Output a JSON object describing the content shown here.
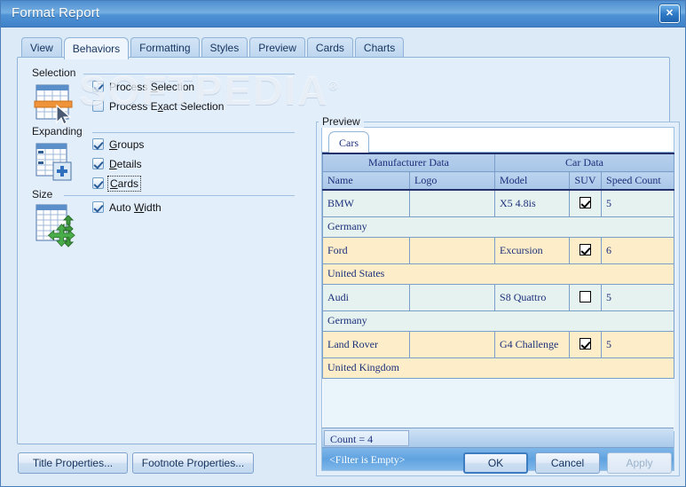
{
  "window": {
    "title": "Format Report",
    "close_label": "✕"
  },
  "watermark": {
    "text": "SOFTPEDIA"
  },
  "tabs": [
    {
      "label": "View",
      "active": false
    },
    {
      "label": "Behaviors",
      "active": true
    },
    {
      "label": "Formatting",
      "active": false
    },
    {
      "label": "Styles",
      "active": false
    },
    {
      "label": "Preview",
      "active": false
    },
    {
      "label": "Cards",
      "active": false
    },
    {
      "label": "Charts",
      "active": false
    }
  ],
  "groups": {
    "selection": {
      "label": "Selection",
      "icon": "table-row-select-icon",
      "options": [
        {
          "label_pre": "Process ",
          "accel": "S",
          "label_post": "election",
          "checked": true
        },
        {
          "label_pre": "Process E",
          "accel": "x",
          "label_post": "act Selection",
          "checked": false
        }
      ]
    },
    "expanding": {
      "label": "Expanding",
      "icon": "table-expand-plus-icon",
      "options": [
        {
          "label_pre": "",
          "accel": "G",
          "label_post": "roups",
          "checked": true,
          "focused": false
        },
        {
          "label_pre": "",
          "accel": "D",
          "label_post": "etails",
          "checked": true,
          "focused": false
        },
        {
          "label_pre": "",
          "accel": "C",
          "label_post": "ards",
          "checked": true,
          "focused": true
        }
      ]
    },
    "size": {
      "label": "Size",
      "icon": "table-resize-arrows-icon",
      "options": [
        {
          "label_pre": "Auto ",
          "accel": "W",
          "label_post": "idth",
          "checked": true
        }
      ]
    }
  },
  "preview": {
    "label": "Preview",
    "grid_tab": "Cars",
    "band_headers": [
      {
        "label": "Manufacturer Data",
        "span": 2
      },
      {
        "label": "Car Data",
        "span": 3
      }
    ],
    "columns": [
      "Name",
      "Logo",
      "Model",
      "SUV",
      "Speed Count"
    ],
    "rows": [
      {
        "type": "data",
        "name": "BMW",
        "logo": "",
        "model": "X5 4.8is",
        "suv": true,
        "speed": "5",
        "tone": "a"
      },
      {
        "type": "group",
        "text": "Germany",
        "tone": "a"
      },
      {
        "type": "data",
        "name": "Ford",
        "logo": "",
        "model": "Excursion",
        "suv": true,
        "speed": "6",
        "tone": "b"
      },
      {
        "type": "group",
        "text": "United States",
        "tone": "b"
      },
      {
        "type": "data",
        "name": "Audi",
        "logo": "",
        "model": "S8 Quattro",
        "suv": false,
        "speed": "5",
        "tone": "a"
      },
      {
        "type": "group",
        "text": "Germany",
        "tone": "a"
      },
      {
        "type": "data",
        "name": "Land Rover",
        "logo": "",
        "model": "G4 Challenge",
        "suv": true,
        "speed": "5",
        "tone": "b"
      },
      {
        "type": "group",
        "text": "United Kingdom",
        "tone": "b"
      }
    ],
    "count_text": "Count = 4",
    "filter_text": "<Filter is Empty>"
  },
  "footer": {
    "title_properties": "Title Properties...",
    "footnote_properties": "Footnote Properties...",
    "ok": "OK",
    "cancel": "Cancel",
    "apply": "Apply"
  },
  "colors": {
    "titlebar": "#4f8ed0",
    "page_bg": "#e3eefb",
    "dialog_bg": "#dce9f7",
    "grid_header": "#a9c6e8",
    "row_tone_a": "#e6f2f0",
    "row_tone_b": "#fdeec9",
    "filter_bar": "#5fa2e0",
    "accent_text": "#1b2f7a"
  }
}
